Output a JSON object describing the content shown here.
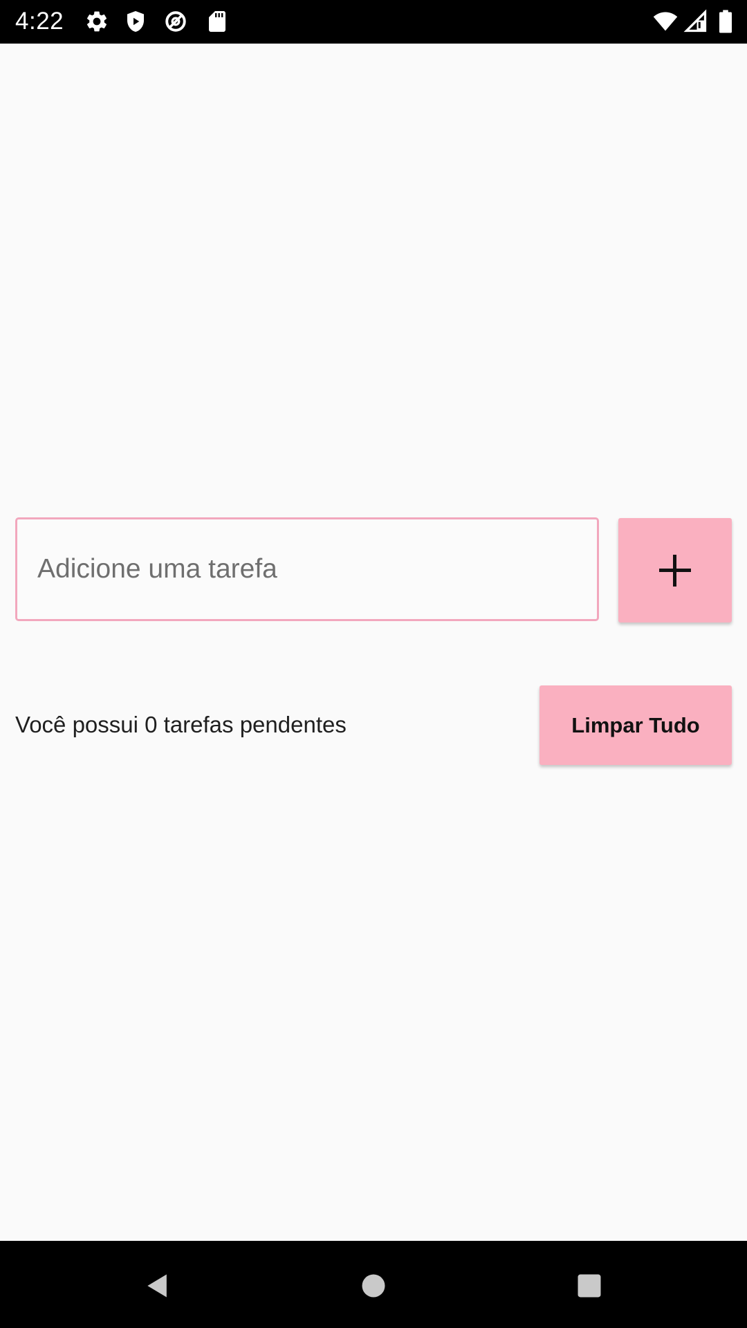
{
  "status_bar": {
    "time": "4:22",
    "left_icons": [
      "gear-icon",
      "play-protect-icon",
      "data-saver-icon",
      "sd-card-icon"
    ],
    "right_icons": [
      "wifi-icon",
      "cell-signal-icon",
      "battery-icon"
    ]
  },
  "task_input": {
    "placeholder": "Adicione uma tarefa",
    "value": ""
  },
  "add_button": {
    "icon": "plus-icon"
  },
  "pending": {
    "text": "Você possui 0 tarefas pendentes"
  },
  "clear_button": {
    "label": "Limpar Tudo"
  },
  "nav_bar": {
    "buttons": [
      "back-icon",
      "home-icon",
      "recents-icon"
    ]
  },
  "colors": {
    "accent": "#fab0c0",
    "input_border": "#f2a7bd",
    "background": "#fafafa",
    "system_bars": "#000000"
  }
}
